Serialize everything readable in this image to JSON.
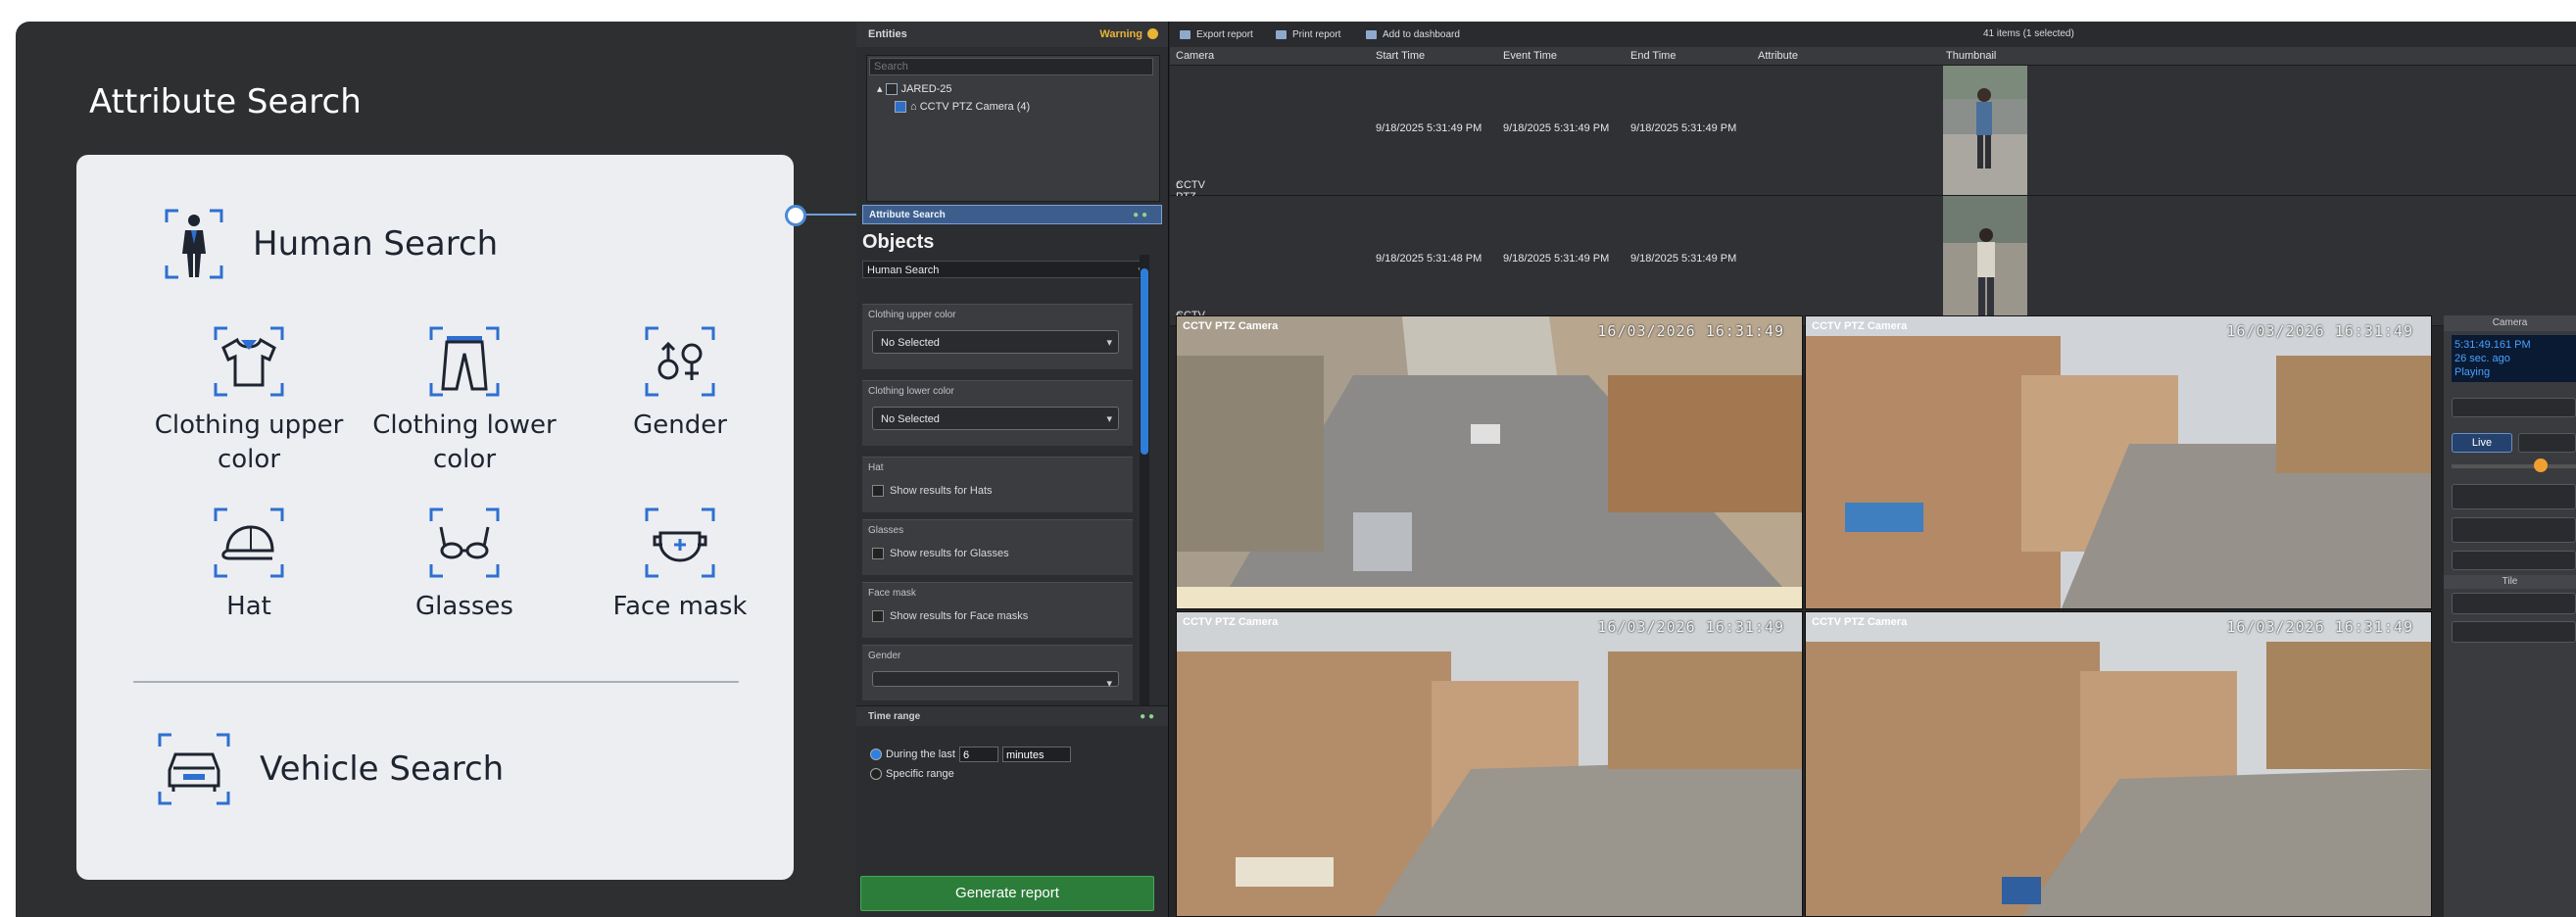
{
  "promo": {
    "title": "Attribute Search",
    "human_search": "Human Search",
    "attributes": [
      {
        "label": "Clothing upper color",
        "icon": "shirt-icon"
      },
      {
        "label": "Clothing lower color",
        "icon": "pants-icon"
      },
      {
        "label": "Gender",
        "icon": "gender-icon"
      },
      {
        "label": "Hat",
        "icon": "cap-icon"
      },
      {
        "label": "Glasses",
        "icon": "glasses-icon"
      },
      {
        "label": "Face mask",
        "icon": "face-mask-icon"
      }
    ],
    "vehicle_search": "Vehicle Search",
    "accent_color": "#2e6fd1"
  },
  "entities": {
    "title": "Entities",
    "warning": "Warning",
    "search_placeholder": "Search",
    "tree_root": "JARED-25",
    "tree_child": "CCTV PTZ Camera (4)"
  },
  "attribute_search": {
    "title": "Attribute Search",
    "objects_label": "Objects",
    "object_selected": "Human Search",
    "filters": [
      {
        "title": "Clothing upper color",
        "value": "No Selected"
      },
      {
        "title": "Clothing lower color",
        "value": "No Selected"
      },
      {
        "title": "Hat",
        "checkbox": "Show results for Hats"
      },
      {
        "title": "Glasses",
        "checkbox": "Show results for Glasses"
      },
      {
        "title": "Face mask",
        "checkbox": "Show results for Face masks"
      },
      {
        "title": "Gender"
      }
    ]
  },
  "time_range": {
    "title": "Time range",
    "option_during": "During the last",
    "amount": "6",
    "unit": "minutes",
    "option_specific": "Specific range"
  },
  "generate_button": "Generate report",
  "toolbar": {
    "export": "Export report",
    "print": "Print report",
    "add_dashboard": "Add to dashboard",
    "count": "41 items (1 selected)"
  },
  "table": {
    "headers": [
      "Camera",
      "Start Time",
      "Event Time",
      "End Time",
      "Attribute",
      "Thumbnail"
    ],
    "rows": [
      [
        "CCTV PTZ Camera",
        "9/18/2025 5:31:49 PM",
        "9/18/2025 5:31:49 PM",
        "9/18/2025 5:31:49 PM"
      ],
      [
        "CCTV PTZ Camera",
        "9/18/2025 5:31:48 PM",
        "9/18/2025 5:31:49 PM",
        "9/18/2025 5:31:49 PM"
      ]
    ]
  },
  "video_tiles": [
    {
      "label": "CCTV PTZ Camera",
      "timestamp": "16/03/2026 16:31:49"
    },
    {
      "label": "CCTV PTZ Camera",
      "timestamp": "16/03/2026 16:31:49"
    },
    {
      "label": "CCTV PTZ Camera",
      "timestamp": "16/03/2026 16:31:49"
    },
    {
      "label": "CCTV PTZ Camera",
      "timestamp": "16/03/2026 16:31:49"
    }
  ],
  "controls": {
    "title": "Camera",
    "time": "5:31:49.161 PM",
    "ago": "26 sec. ago",
    "state": "Playing",
    "live": "Live",
    "tile": "Tile"
  }
}
